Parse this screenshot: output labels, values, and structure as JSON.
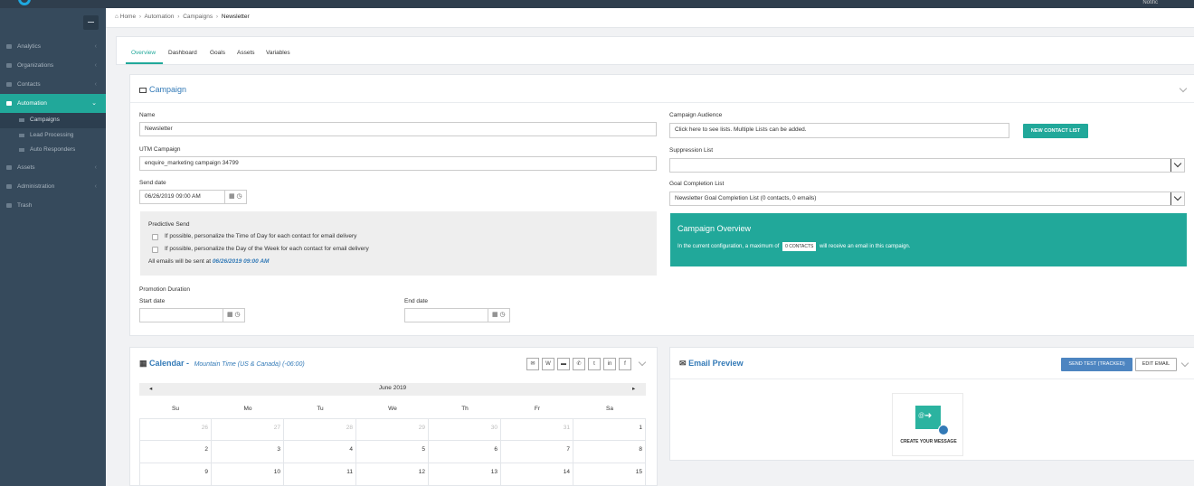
{
  "topbar": {
    "user_label": "Notific"
  },
  "sidebar": {
    "items": [
      {
        "label": "Analytics"
      },
      {
        "label": "Organizations"
      },
      {
        "label": "Contacts"
      },
      {
        "label": "Automation"
      },
      {
        "label": "Assets"
      },
      {
        "label": "Administration"
      },
      {
        "label": "Trash"
      }
    ],
    "sub_items": [
      {
        "label": "Campaigns"
      },
      {
        "label": "Lead Processing"
      },
      {
        "label": "Auto Responders"
      }
    ]
  },
  "breadcrumb": {
    "home": "Home",
    "automation": "Automation",
    "campaigns": "Campaigns",
    "current": "Newsletter"
  },
  "tabs": [
    "Overview",
    "Dashboard",
    "Goals",
    "Assets",
    "Variables"
  ],
  "campaign": {
    "title": "Campaign",
    "name_label": "Name",
    "name_value": "Newsletter",
    "utm_label": "UTM Campaign",
    "utm_value": "enquire_marketing campaign 34799",
    "send_date_label": "Send date",
    "send_date_value": "06/26/2019 09:00 AM",
    "predictive_title": "Predictive Send",
    "predictive_opt1": "If possible, personalize the Time of Day for each contact for email delivery",
    "predictive_opt2": "If possible, personalize the Day of the Week for each contact for email delivery",
    "sent_at_prefix": "All emails will be sent at",
    "sent_at_value": "06/26/2019 09:00 AM",
    "promotion_label": "Promotion Duration",
    "start_date_label": "Start date",
    "end_date_label": "End date",
    "audience_label": "Campaign Audience",
    "audience_placeholder": "Click here to see lists. Multiple Lists can be added.",
    "new_list_button": "NEW CONTACT LIST",
    "suppression_label": "Suppression List",
    "suppression_value": "",
    "goal_label": "Goal Completion List",
    "goal_value": "Newsletter Goal Completion List (0 contacts, 0 emails)",
    "overview_title": "Campaign Overview",
    "overview_text_before": "In the current configuration, a maximum of",
    "overview_badge": "0 CONTACTS",
    "overview_text_after": "will receive an email in this campaign."
  },
  "calendar": {
    "title": "Calendar -",
    "timezone": "Mountain Time (US & Canada) (-06:00)",
    "month": "June 2019",
    "prev": "◂",
    "next": "▸",
    "days": [
      "Su",
      "Mo",
      "Tu",
      "We",
      "Th",
      "Fr",
      "Sa"
    ],
    "weeks": [
      [
        "26",
        "27",
        "28",
        "29",
        "30",
        "31",
        "1"
      ],
      [
        "2",
        "3",
        "4",
        "5",
        "6",
        "7",
        "8"
      ],
      [
        "9",
        "10",
        "11",
        "12",
        "13",
        "14",
        "15"
      ]
    ],
    "toolbar_icons": [
      "email-icon",
      "wordpress-icon",
      "chat-icon",
      "phone-icon",
      "twitter-icon",
      "linkedin-icon",
      "facebook-icon"
    ],
    "toolbar_glyphs": [
      "✉",
      "W",
      "▬",
      "✆",
      "t",
      "in",
      "f"
    ]
  },
  "email_preview": {
    "title": "Email Preview",
    "send_test_button": "SEND TEST (TRACKED)",
    "edit_button": "EDIT EMAIL",
    "tile_label": "CREATE YOUR MESSAGE",
    "tile_at": "@"
  },
  "colors": {
    "accent": "#21a89a",
    "sidebar": "#364a5c",
    "topbar": "#2f3e4d",
    "link": "#337ab7"
  }
}
